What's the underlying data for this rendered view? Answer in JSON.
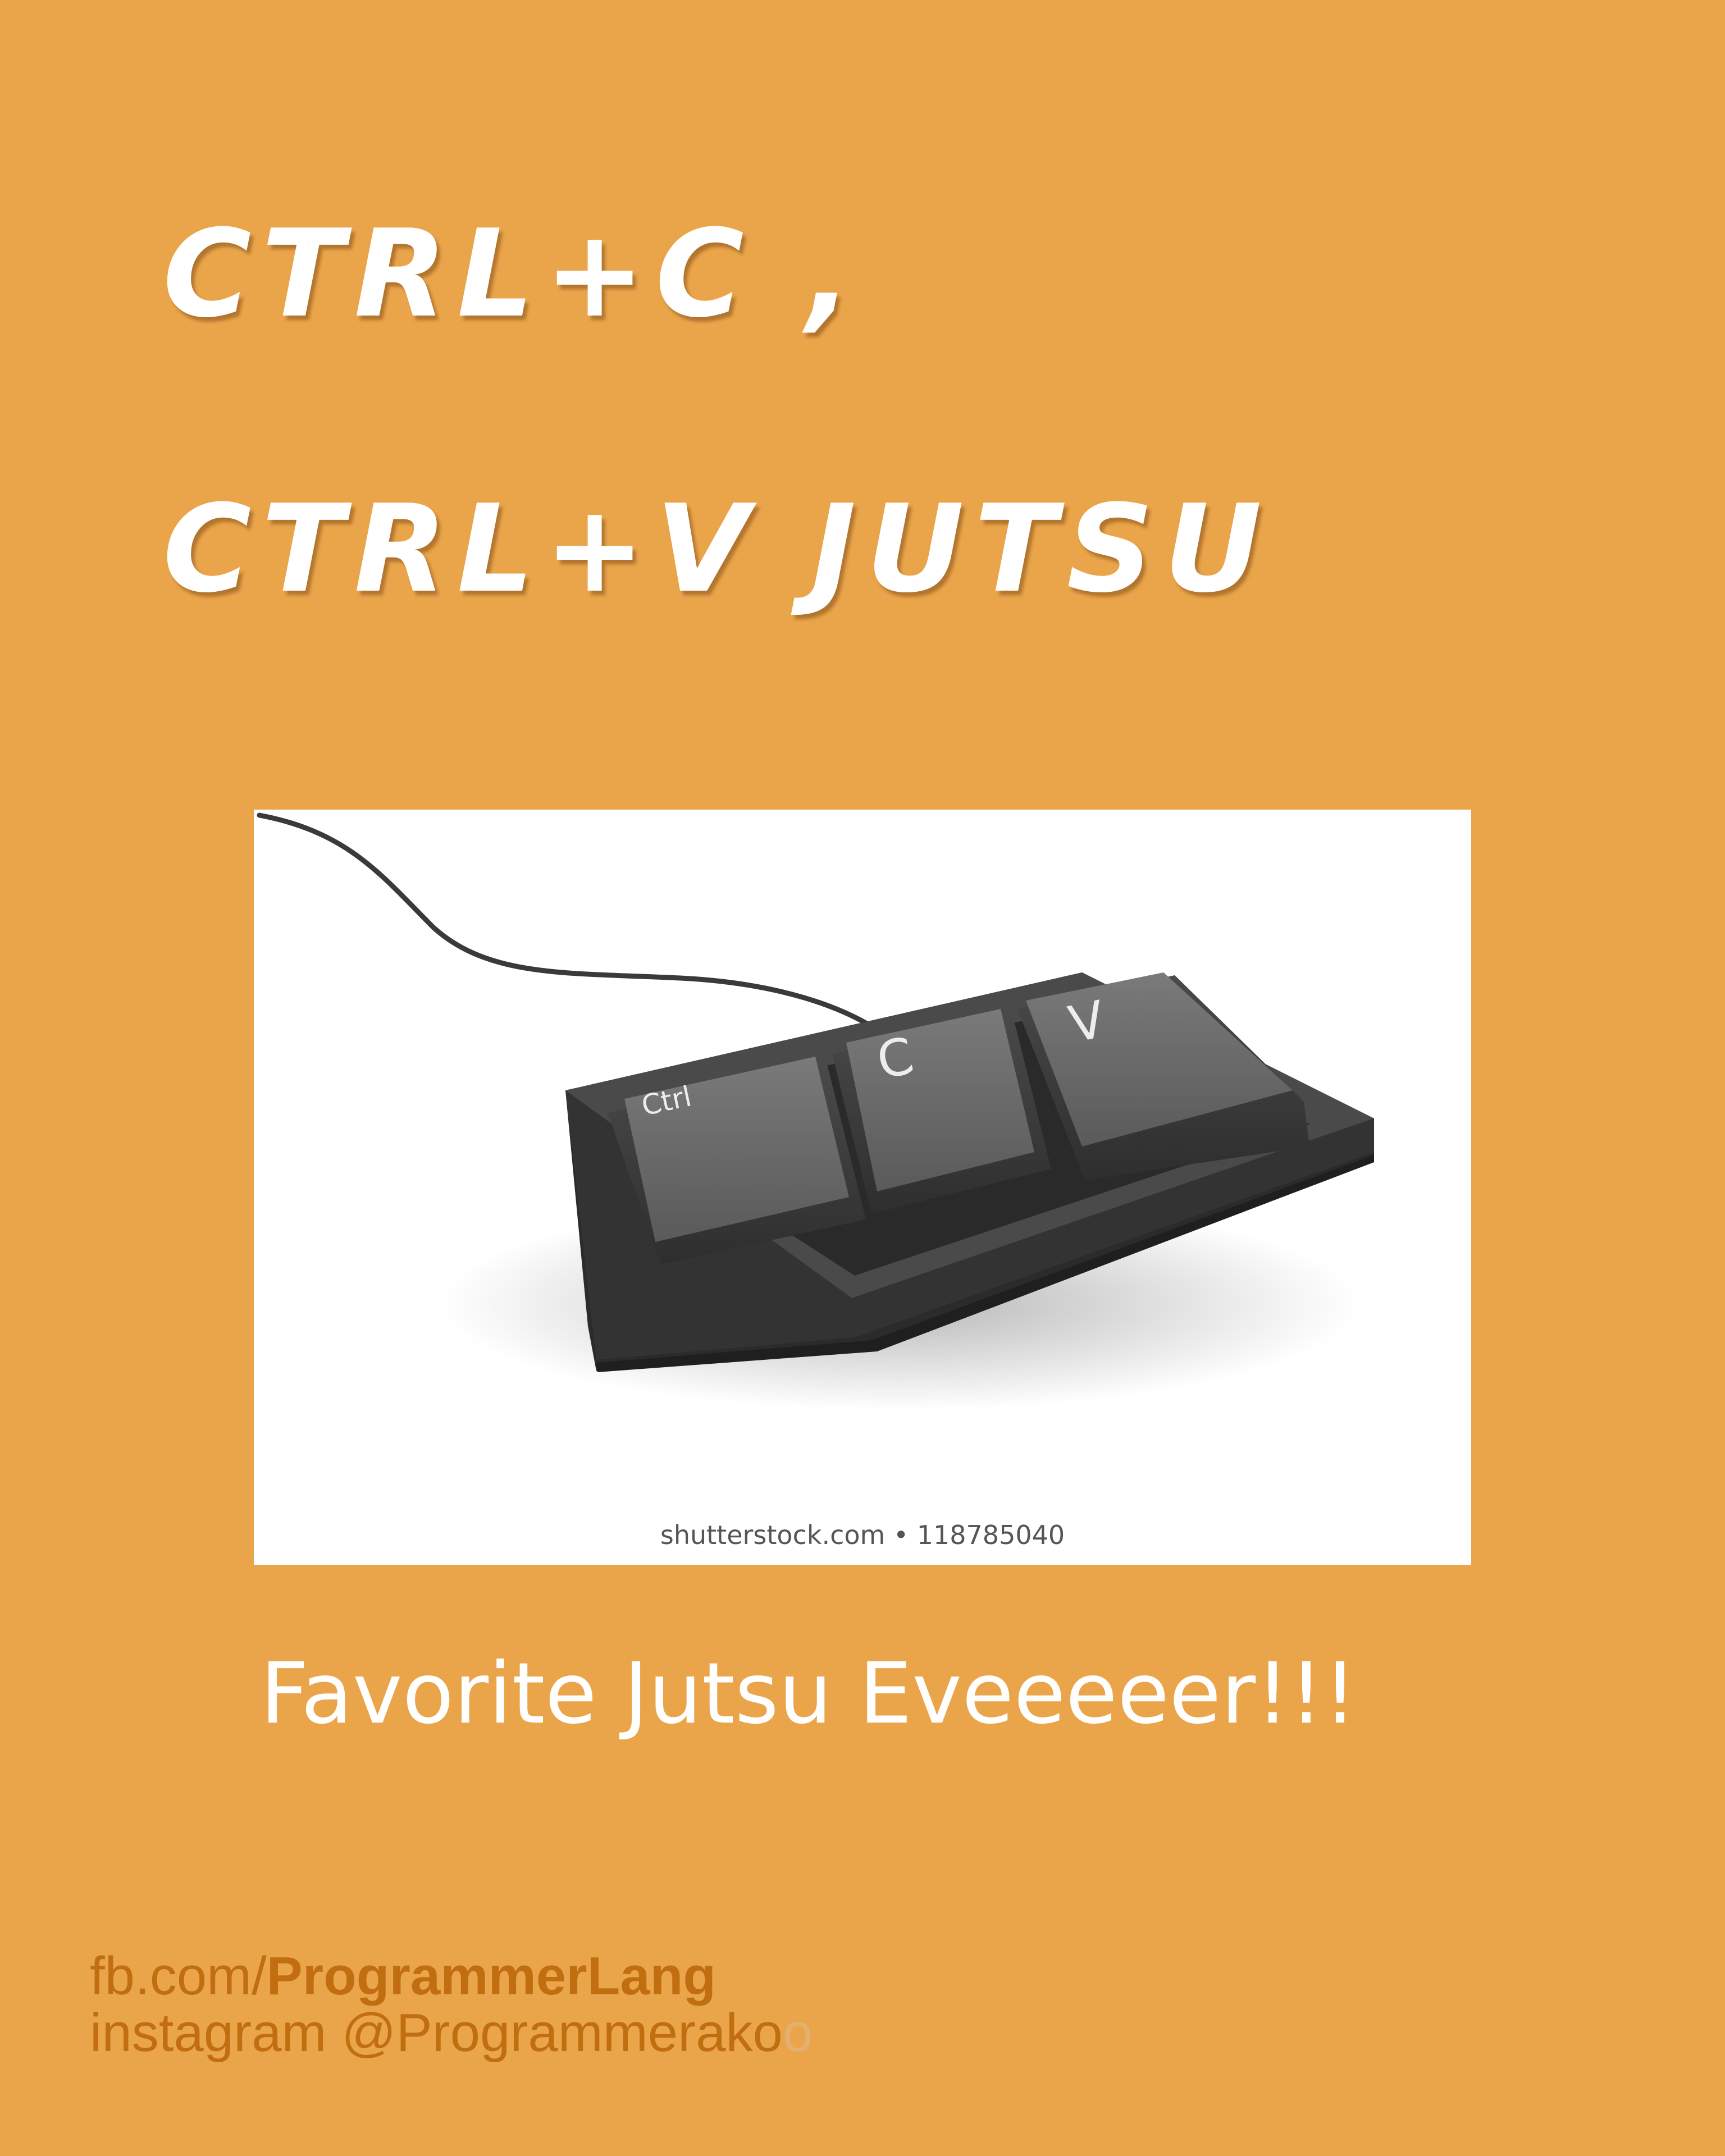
{
  "colors": {
    "background": "#EAA54B",
    "title": "#FFFFFF",
    "caption": "#FFFFFF",
    "credits": "#C06E10",
    "keycap": "#5E5E5E",
    "keyboard_tray": "#3C3C3C"
  },
  "title": {
    "line1": "CTRL+C ,",
    "line2": "CTRL+V JUTSU"
  },
  "image": {
    "icon": "ctrl-c-v-keyboard-icon",
    "keys": {
      "ctrl": "Ctrl",
      "c": "C",
      "v": "V"
    },
    "watermark": "shutterstock.com • 118785040"
  },
  "caption": "Favorite Jutsu Eveeeeer!!!",
  "credits": {
    "facebook_prefix": "fb.com/",
    "facebook_page": "ProgrammerLang",
    "instagram": "instagram @Programmerako",
    "instagram_trailing": "o"
  }
}
